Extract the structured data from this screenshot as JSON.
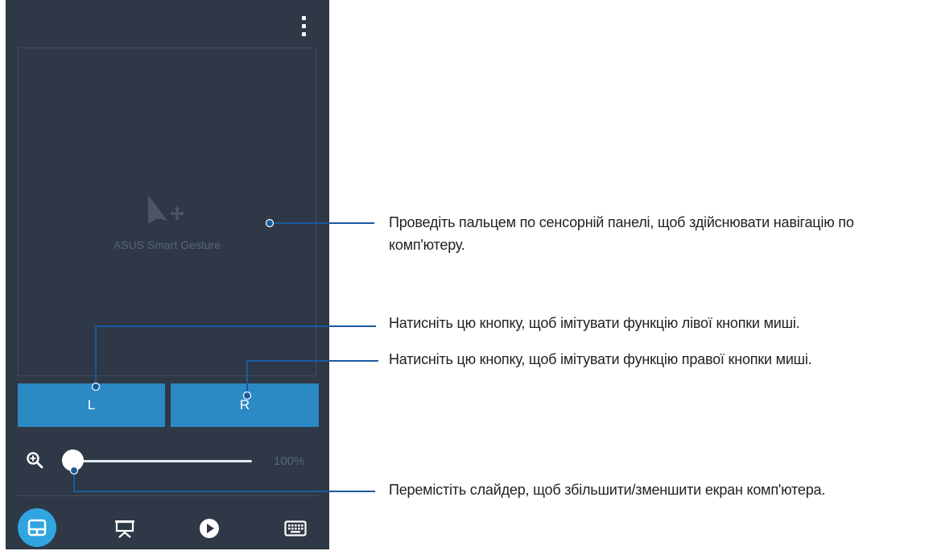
{
  "phone": {
    "touchpad_label": "ASUS Smart Gesture",
    "left_button_label": "L",
    "right_button_label": "R",
    "zoom_value": "100%",
    "zoom_level_fraction": 0.0,
    "icons": {
      "menu": "overflow-menu-icon",
      "touchpad": "cursor-move-icon",
      "zoom": "zoom-in-icon",
      "nav": [
        "touchpad-icon",
        "presentation-icon",
        "play-icon",
        "keyboard-icon"
      ]
    },
    "colors": {
      "background": "#2e3846",
      "button": "#2b8ac4",
      "active_nav": "#31a5e0"
    }
  },
  "callouts": {
    "touchpad": "Проведіть пальцем по сенсорній панелі, щоб здійснювати навігацію по комп'ютеру.",
    "left_button": "Натисніть цю кнопку, щоб імітувати функцію лівої кнопки миші.",
    "right_button": "Натисніть цю кнопку, щоб імітувати функцію правої кнопки миші.",
    "slider": "Перемістіть слайдер, щоб збільшити/зменшити екран комп'ютера.",
    "line_color": "#1a5a9e"
  }
}
